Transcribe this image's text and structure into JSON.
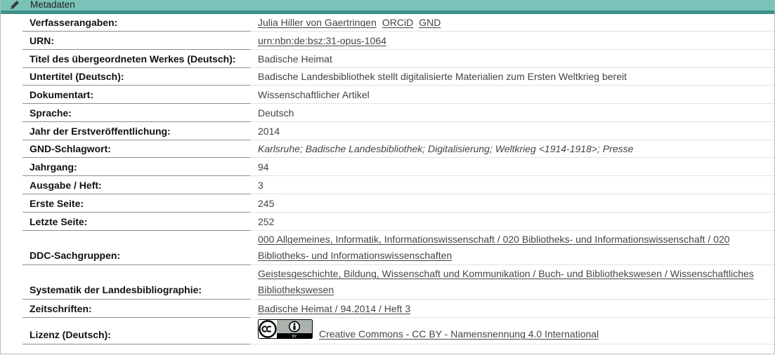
{
  "section_title": "Metadaten",
  "rows": [
    {
      "label": "Verfasserangaben:",
      "links": [
        "Julia Hiller von Gaertringen",
        "ORCiD",
        "GND"
      ]
    },
    {
      "label": "URN:",
      "links": [
        "urn:nbn:de:bsz:31-opus-1064"
      ]
    },
    {
      "label": "Titel des übergeordneten Werkes (Deutsch):",
      "value": "Badische Heimat"
    },
    {
      "label": "Untertitel (Deutsch):",
      "value": "Badische Landesbibliothek stellt digitalisierte Materialien zum Ersten Weltkrieg bereit"
    },
    {
      "label": "Dokumentart:",
      "value": "Wissenschaftlicher Artikel"
    },
    {
      "label": "Sprache:",
      "value": "Deutsch"
    },
    {
      "label": "Jahr der Erstveröffentlichung:",
      "value": "2014"
    },
    {
      "label": "GND-Schlagwort:",
      "value": "Karlsruhe; Badische Landesbibliothek; Digitalisierung; Weltkrieg <1914-1918>; Presse"
    },
    {
      "label": "Jahrgang:",
      "value": "94"
    },
    {
      "label": "Ausgabe / Heft:",
      "value": "3"
    },
    {
      "label": "Erste Seite:",
      "value": "245"
    },
    {
      "label": "Letzte Seite:",
      "value": "252"
    },
    {
      "label": "DDC-Sachgruppen:",
      "links": [
        "000 Allgemeines, Informatik, Informationswissenschaft / 020 Bibliotheks- und Informationswissenschaft / 020 Bibliotheks- und Informationswissenschaften"
      ]
    },
    {
      "label": "Systematik der Landesbibliographie:",
      "links": [
        "Geistesgeschichte, Bildung, Wissenschaft und Kommunikation / Buch- und Bibliothekswesen / Wissenschaftliches Bibliothekswesen"
      ]
    },
    {
      "label": "Zeitschriften:",
      "links": [
        "Badische Heimat / 94.2014 / Heft 3"
      ]
    },
    {
      "label": "Lizenz (Deutsch):",
      "links": [
        "Creative Commons - CC BY - Namensnennung 4.0 International"
      ]
    }
  ]
}
